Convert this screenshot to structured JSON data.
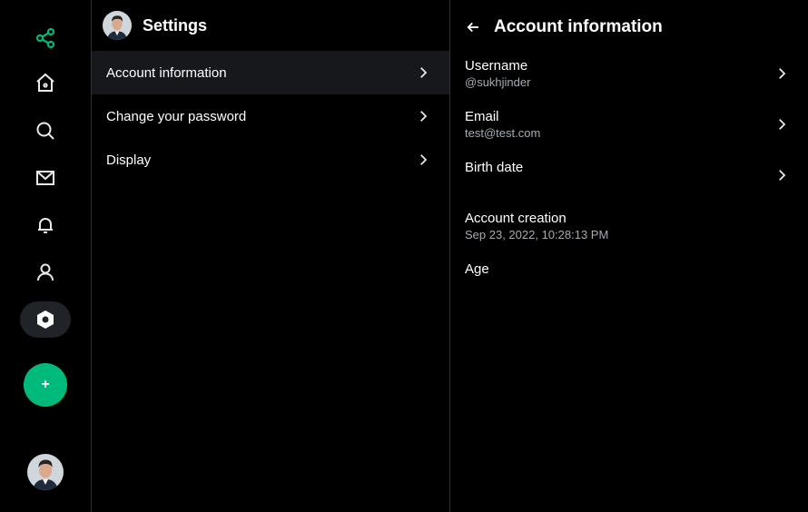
{
  "sidebar": {
    "icons": [
      "share-logo-icon",
      "home-icon",
      "search-icon",
      "mail-icon",
      "bell-icon",
      "profile-icon",
      "settings-icon"
    ],
    "compose_label": "+",
    "accent_color": "#00ba7c"
  },
  "settings": {
    "title": "Settings",
    "items": [
      {
        "label": "Account information",
        "active": true
      },
      {
        "label": "Change your password",
        "active": false
      },
      {
        "label": "Display",
        "active": false
      }
    ]
  },
  "account": {
    "title": "Account information",
    "username": {
      "label": "Username",
      "value": "@sukhjinder"
    },
    "email": {
      "label": "Email",
      "value": "test@test.com"
    },
    "birth_date": {
      "label": "Birth date"
    },
    "account_creation": {
      "label": "Account creation",
      "value": "Sep 23, 2022, 10:28:13 PM"
    },
    "age": {
      "label": "Age"
    }
  }
}
